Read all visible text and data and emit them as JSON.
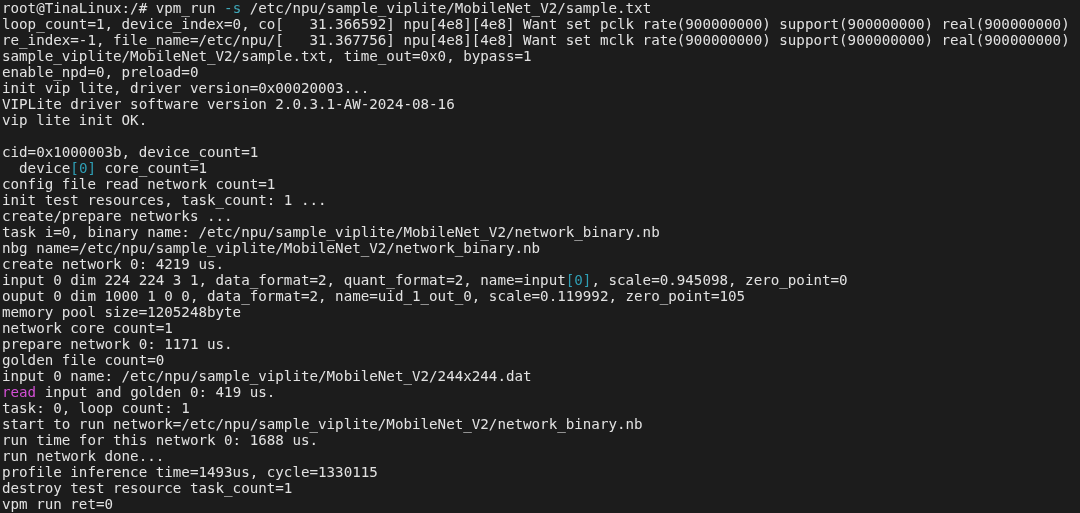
{
  "terminal": {
    "blocks": [
      {
        "lines": [
          {
            "segments": [
              {
                "kind": "text",
                "text": "root@TinaLinux:/# vpm_run "
              },
              {
                "kind": "option",
                "text": "-s"
              },
              {
                "kind": "text",
                "text": " /etc/npu/sample_viplite/MobileNet_V2/sample.txt"
              }
            ]
          },
          {
            "segments": [
              {
                "kind": "text",
                "text": "loop_count=1, device_index=0, co[   31.366592] npu[4e8][4e8] Want set pclk rate(900000000) support(900000000) real(900000000)"
              }
            ]
          },
          {
            "segments": [
              {
                "kind": "text",
                "text": "re_index=-1, file_name=/etc/npu/[   31.367756] npu[4e8][4e8] Want set mclk rate(900000000) support(900000000) real(900000000)"
              }
            ]
          },
          {
            "segments": [
              {
                "kind": "text",
                "text": "sample_viplite/MobileNet_V2/sample.txt, time_out=0x0, bypass=1"
              }
            ]
          },
          {
            "segments": [
              {
                "kind": "text",
                "text": "enable_npd=0, preload=0"
              }
            ]
          },
          {
            "segments": [
              {
                "kind": "text",
                "text": "init vip lite, driver version=0x00020003..."
              }
            ]
          },
          {
            "segments": [
              {
                "kind": "text",
                "text": "VIPLite driver software version 2.0.3.1-AW-2024-08-16"
              }
            ]
          },
          {
            "segments": [
              {
                "kind": "text",
                "text": "vip lite init OK."
              }
            ]
          }
        ]
      },
      {
        "lines": [
          {
            "segments": [
              {
                "kind": "text",
                "text": "cid=0x1000003b, device_count=1"
              }
            ]
          },
          {
            "segments": [
              {
                "kind": "text",
                "text": "  device"
              },
              {
                "kind": "index",
                "text": "[0]"
              },
              {
                "kind": "text",
                "text": " core_count=1"
              }
            ]
          },
          {
            "segments": [
              {
                "kind": "text",
                "text": "config file read network count=1"
              }
            ]
          },
          {
            "segments": [
              {
                "kind": "text",
                "text": "init test resources, task_count: 1 ..."
              }
            ]
          },
          {
            "segments": [
              {
                "kind": "text",
                "text": "create/prepare networks ..."
              }
            ]
          },
          {
            "segments": [
              {
                "kind": "text",
                "text": "task i=0, binary name: /etc/npu/sample_viplite/MobileNet_V2/network_binary.nb"
              }
            ]
          },
          {
            "segments": [
              {
                "kind": "text",
                "text": "nbg name=/etc/npu/sample_viplite/MobileNet_V2/network_binary.nb"
              }
            ]
          },
          {
            "segments": [
              {
                "kind": "text",
                "text": "create network 0: 4219 us."
              }
            ]
          },
          {
            "segments": [
              {
                "kind": "text",
                "text": "input 0 dim 224 224 3 1, data_format=2, quant_format=2, name=input"
              },
              {
                "kind": "index",
                "text": "[0]"
              },
              {
                "kind": "text",
                "text": ", scale=0.945098, zero_point=0"
              }
            ]
          },
          {
            "segments": [
              {
                "kind": "text",
                "text": "ouput 0 dim 1000 1 0 0, data_format=2, name=uid_1_out_0, scale=0.119992, zero_point=105"
              }
            ]
          },
          {
            "segments": [
              {
                "kind": "text",
                "text": "memory pool size=1205248byte"
              }
            ]
          },
          {
            "segments": [
              {
                "kind": "text",
                "text": "network core count=1"
              }
            ]
          },
          {
            "segments": [
              {
                "kind": "text",
                "text": "prepare network 0: 1171 us."
              }
            ]
          },
          {
            "segments": [
              {
                "kind": "text",
                "text": "golden file count=0"
              }
            ]
          },
          {
            "segments": [
              {
                "kind": "text",
                "text": "input 0 name: /etc/npu/sample_viplite/MobileNet_V2/244x244.dat"
              }
            ]
          },
          {
            "segments": [
              {
                "kind": "keyword",
                "text": "read"
              },
              {
                "kind": "text",
                "text": " input and golden 0: 419 us."
              }
            ]
          },
          {
            "segments": [
              {
                "kind": "text",
                "text": "task: 0, loop count: 1"
              }
            ]
          },
          {
            "segments": [
              {
                "kind": "text",
                "text": "start to run network=/etc/npu/sample_viplite/MobileNet_V2/network_binary.nb"
              }
            ]
          },
          {
            "segments": [
              {
                "kind": "text",
                "text": "run time for this network 0: 1688 us."
              }
            ]
          },
          {
            "segments": [
              {
                "kind": "text",
                "text": "run network done..."
              }
            ]
          },
          {
            "segments": [
              {
                "kind": "text",
                "text": "profile inference time=1493us, cycle=1330115"
              }
            ]
          },
          {
            "segments": [
              {
                "kind": "text",
                "text": "destroy test resource task_count=1"
              }
            ]
          },
          {
            "segments": [
              {
                "kind": "text",
                "text": "vpm run ret=0"
              }
            ]
          }
        ]
      }
    ]
  }
}
